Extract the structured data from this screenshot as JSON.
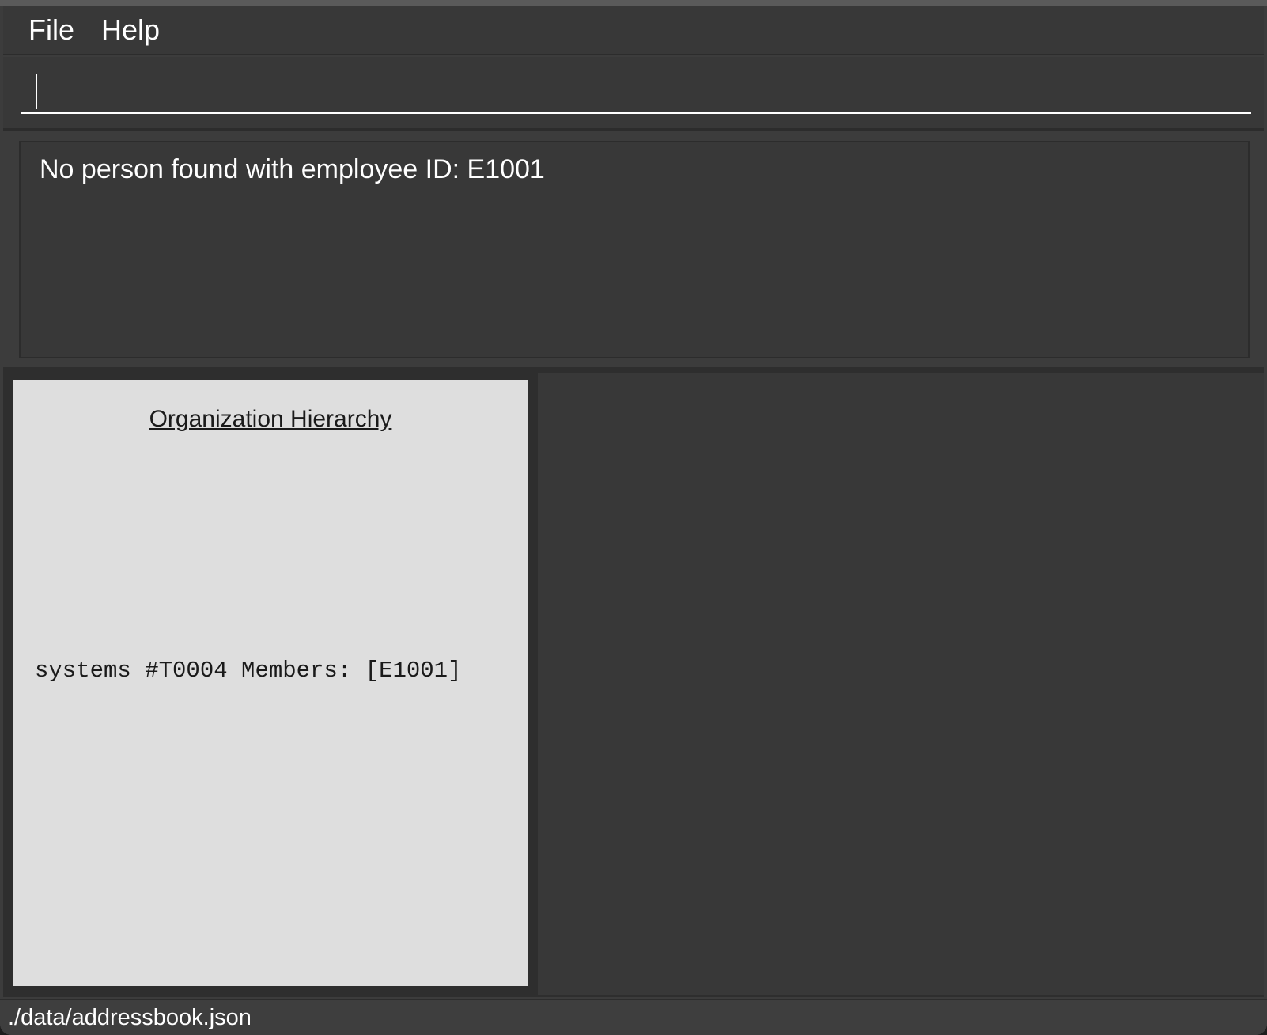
{
  "menu": {
    "items": [
      {
        "label": "File"
      },
      {
        "label": "Help"
      }
    ]
  },
  "command": {
    "value": ""
  },
  "result": {
    "message": "No person found with employee ID: E1001"
  },
  "hierarchy": {
    "title": "Organization Hierarchy",
    "entries": [
      {
        "text": "systems #T0004 Members: [E1001]"
      }
    ]
  },
  "status": {
    "file_path": "./data/addressbook.json"
  }
}
